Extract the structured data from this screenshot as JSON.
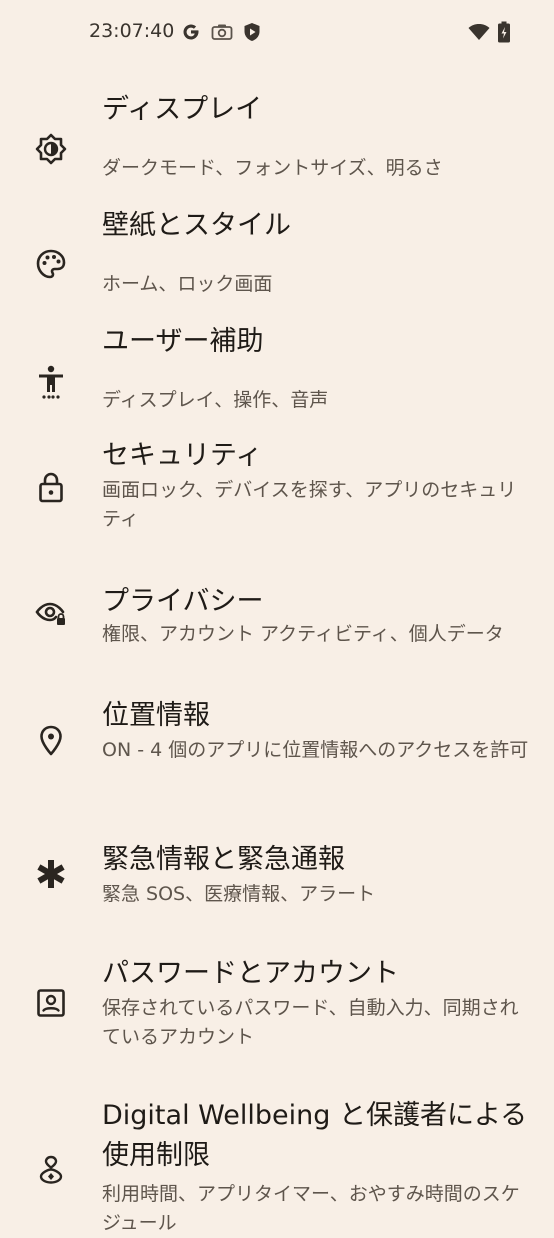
{
  "status_bar": {
    "time": "23:07:40",
    "icons": [
      "google-g-icon",
      "camera-icon",
      "shield-icon",
      "wifi-icon",
      "battery-icon"
    ]
  },
  "settings": [
    {
      "icon": "display-brightness-icon",
      "title": "ディスプレイ",
      "summary": "ダークモード、フォントサイズ、明るさ"
    },
    {
      "icon": "palette-icon",
      "title": "壁紙とスタイル",
      "summary": "ホーム、ロック画面"
    },
    {
      "icon": "accessibility-icon",
      "title": "ユーザー補助",
      "summary": "ディスプレイ、操作、音声"
    },
    {
      "icon": "lock-icon",
      "title": "セキュリティ",
      "summary": "画面ロック、デバイスを探す、アプリのセキュリティ"
    },
    {
      "icon": "privacy-eye-icon",
      "title": "プライバシー",
      "summary": "権限、アカウント アクティビティ、個人データ"
    },
    {
      "icon": "location-pin-icon",
      "title": "位置情報",
      "summary": "ON - 4 個のアプリに位置情報へのアクセスを許可"
    },
    {
      "icon": "asterisk-icon",
      "title": "緊急情報と緊急通報",
      "summary": "緊急 SOS、医療情報、アラート"
    },
    {
      "icon": "account-box-icon",
      "title": "パスワードとアカウント",
      "summary": "保存されているパスワード、自動入力、同期されているアカウント"
    },
    {
      "icon": "wellbeing-icon",
      "title": "Digital Wellbeing と保護者による使用制限",
      "summary": "利用時間、アプリタイマー、おやすみ時間のスケジュール"
    }
  ]
}
